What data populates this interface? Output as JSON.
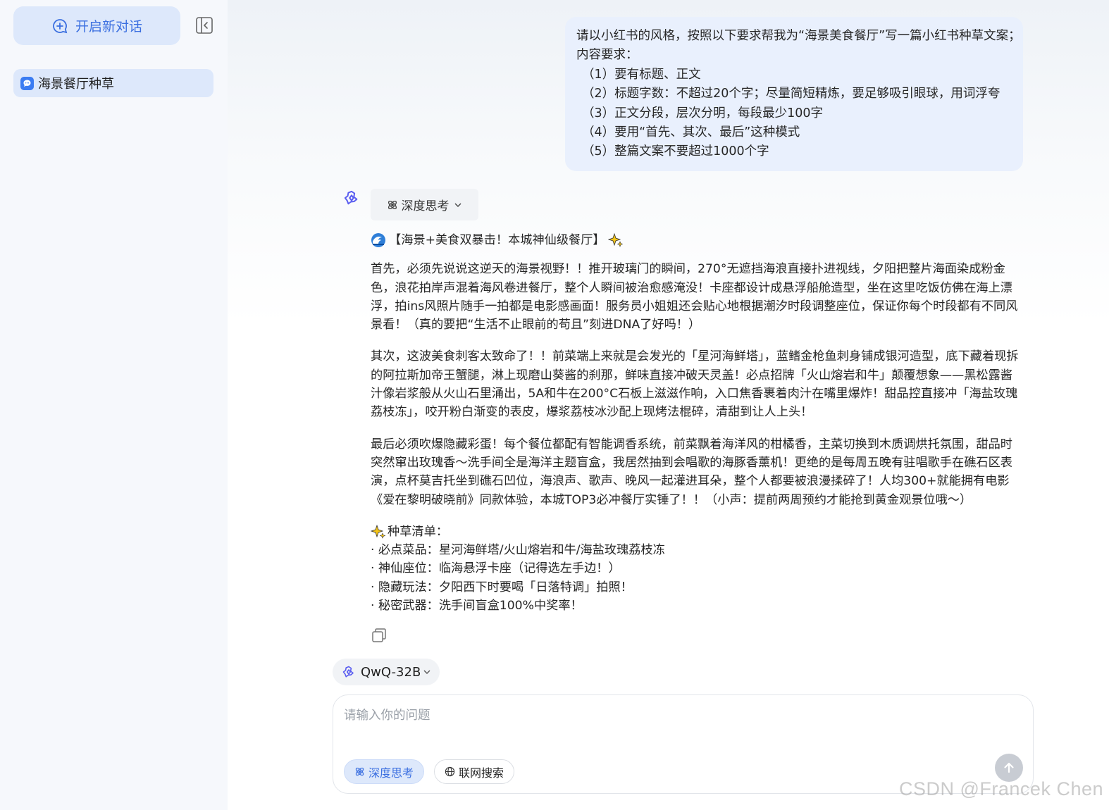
{
  "sidebar": {
    "new_chat_label": "开启新对话",
    "history": [
      {
        "label": "海景餐厅种草"
      }
    ]
  },
  "conversation": {
    "user_prompt_lines": [
      "请以小红书的风格，按照以下要求帮我为“海景美食餐厅”写一篇小红书种草文案；",
      "内容要求：",
      "（1）要有标题、正文",
      "（2）标题字数：不超过20个字；尽量简短精炼，要足够吸引眼球，用词浮夸",
      "（3）正文分段，层次分明，每段最少100字",
      "（4）要用“首先、其次、最后”这种模式",
      "（5）整篇文案不要超过1000个字"
    ],
    "think_chip_label": "深度思考",
    "answer": {
      "title": "【海景+美食双暴击！本城神仙级餐厅】",
      "paragraph_1": "首先，必须先说说这逆天的海景视野！！推开玻璃门的瞬间，270°无遮挡海浪直接扑进视线，夕阳把整片海面染成粉金色，浪花拍岸声混着海风卷进餐厅，整个人瞬间被治愈感淹没！卡座都设计成悬浮船舱造型，坐在这里吃饭仿佛在海上漂浮，拍ins风照片随手一拍都是电影感画面！服务员小姐姐还会贴心地根据潮汐时段调整座位，保证你每个时段都有不同风景看！（真的要把“生活不止眼前的苟且”刻进DNA了好吗！）",
      "paragraph_2": "其次，这波美食刺客太致命了！！前菜端上来就是会发光的「星河海鲜塔」，蓝鳍金枪鱼刺身铺成银河造型，底下藏着现拆的阿拉斯加帝王蟹腿，淋上现磨山葵酱的刹那，鲜味直接冲破天灵盖！必点招牌「火山熔岩和牛」颠覆想象——黑松露酱汁像岩浆般从火山石里涌出，5A和牛在200°C石板上滋滋作响，入口焦香裹着肉汁在嘴里爆炸！甜品控直接冲「海盐玫瑰荔枝冻」，咬开粉白渐变的表皮，爆浆荔枝冰沙配上现烤法棍碎，清甜到让人上头！",
      "paragraph_3": "最后必须吹爆隐藏彩蛋！每个餐位都配有智能调香系统，前菜飘着海洋风的柑橘香，主菜切换到木质调烘托氛围，甜品时突然窜出玫瑰香～洗手间全是海洋主题盲盒，我居然抽到会唱歌的海豚香薰机！更绝的是每周五晚有驻唱歌手在礁石区表演，点杯莫吉托坐到礁石凹位，海浪声、歌声、晚风一起灌进耳朵，整个人都要被浪漫揉碎了！人均300+就能拥有电影《爱在黎明破晓前》同款体验，本城TOP3必冲餐厅实锤了！！（小声：提前两周预约才能抢到黄金观景位哦～）",
      "list_title": "种草清单：",
      "list_items": [
        "· 必点菜品：星河海鲜塔/火山熔岩和牛/海盐玫瑰荔枝冻",
        "· 神仙座位：临海悬浮卡座（记得选左手边！）",
        "· 隐藏玩法：夕阳西下时要喝「日落特调」拍照！",
        "· 秘密武器：洗手间盲盒100%中奖率！"
      ]
    }
  },
  "composer": {
    "model_label": "QwQ-32B",
    "placeholder": "请输入你的问题",
    "think_label": "深度思考",
    "web_label": "联网搜索"
  },
  "watermark": "CSDN @Francek Chen",
  "colors": {
    "accent": "#3b6fe0",
    "sidebar_bg": "#f6f8fc",
    "bubble_bg": "#e9f0fd",
    "chip_bg": "#f1f3f6"
  },
  "icons": {
    "new_chat": "chat-plus-icon",
    "collapse": "collapse-sidebar-icon",
    "history": "chat-bubble-icon",
    "assistant": "qwen-logo-icon",
    "think": "atom-icon",
    "web": "globe-icon",
    "copy": "copy-icon",
    "send": "arrow-up-icon"
  }
}
